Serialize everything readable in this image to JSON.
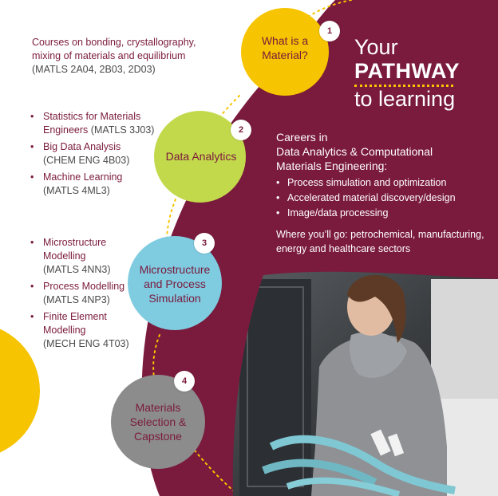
{
  "intro": {
    "line1": "Courses on bonding, crystallography,",
    "line2": "mixing of materials and equilibrium",
    "codes": "(MATLS 2A04, 2B03, 2D03)"
  },
  "steps": [
    {
      "number": "1",
      "line1": "What is a",
      "line2": "Material?",
      "color": "#f6c400"
    },
    {
      "number": "2",
      "line1": "Data Analytics",
      "color": "#c3d94c"
    },
    {
      "number": "3",
      "line1": "Microstructure",
      "line2": "and Process",
      "line3": "Simulation",
      "color": "#7fcbe0"
    },
    {
      "number": "4",
      "line1": "Materials",
      "line2": "Selection &",
      "line3": "Capstone",
      "color": "#8c8c8c"
    }
  ],
  "data_analytics_courses": [
    {
      "title_line1": "Statistics for Materials",
      "title_line2": "Engineers",
      "code": "(MATLS 3J03)"
    },
    {
      "title_line1": "Big Data Analysis",
      "code": "(CHEM ENG 4B03)"
    },
    {
      "title_line1": "Machine Learning",
      "code": "(MATLS 4ML3)"
    }
  ],
  "simulation_courses": [
    {
      "title_line1": "Microstructure",
      "title_line2": "Modelling",
      "code": "(MATLS 4NN3)"
    },
    {
      "title_line1": "Process Modelling",
      "code": "(MATLS 4NP3)"
    },
    {
      "title_line1": "Finite Element",
      "title_line2": "Modelling",
      "code": "(MECH ENG 4T03)"
    }
  ],
  "headline": {
    "your": "Your",
    "pathway": "PATHWAY",
    "to_learning": "to learning"
  },
  "careers": {
    "line1": "Careers in",
    "line2": "Data Analytics & Computational",
    "line3": "Materials Engineering:",
    "items": [
      "Process simulation and optimization",
      "Accelerated material discovery/design",
      "Image/data processing"
    ],
    "where_line1": "Where you’ll go: petrochemical, manufacturing,",
    "where_line2": "energy and healthcare sectors"
  },
  "colors": {
    "maroon": "#7a1a3c",
    "yellow": "#f6c400",
    "green": "#c3d94c",
    "blue": "#7fcbe0",
    "gray": "#8c8c8c"
  }
}
